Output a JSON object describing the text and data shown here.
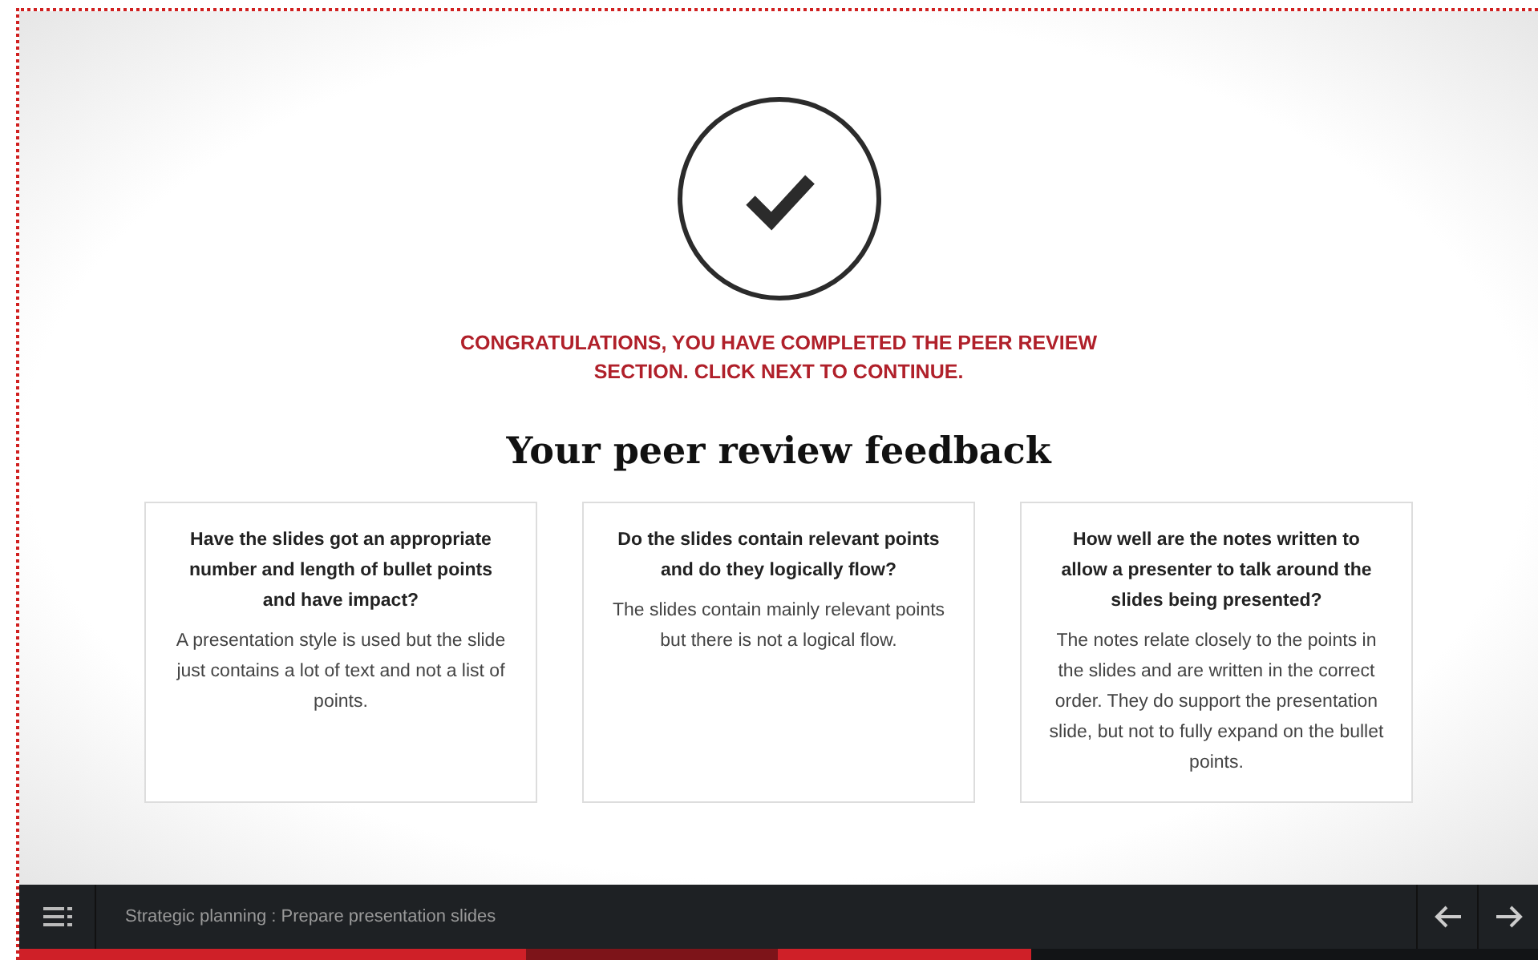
{
  "message": "CONGRATULATIONS, YOU HAVE COMPLETED THE PEER REVIEW SECTION. CLICK NEXT TO CONTINUE.",
  "heading": "Your peer review feedback",
  "cards": [
    {
      "question": "Have the slides got an appropriate number and length of bullet points and have impact?",
      "answer": "A presentation style is used but the slide just contains a lot of text and not a list of points."
    },
    {
      "question": "Do the slides contain relevant points and do they logically flow?",
      "answer": "The slides contain mainly relevant points but there is not a logical flow."
    },
    {
      "question": "How well are the notes written to allow a presenter to talk around the slides being presented?",
      "answer": "The notes relate closely to the points in the slides and are written in the correct order. They do support the presentation slide, but not to fully expand on the bullet points."
    }
  ],
  "footer": {
    "title": "Strategic planning : Prepare presentation slides"
  },
  "progress": [
    {
      "kind": "done"
    },
    {
      "kind": "done"
    },
    {
      "kind": "current"
    },
    {
      "kind": "done"
    },
    {
      "kind": "todo"
    },
    {
      "kind": "todo"
    }
  ]
}
